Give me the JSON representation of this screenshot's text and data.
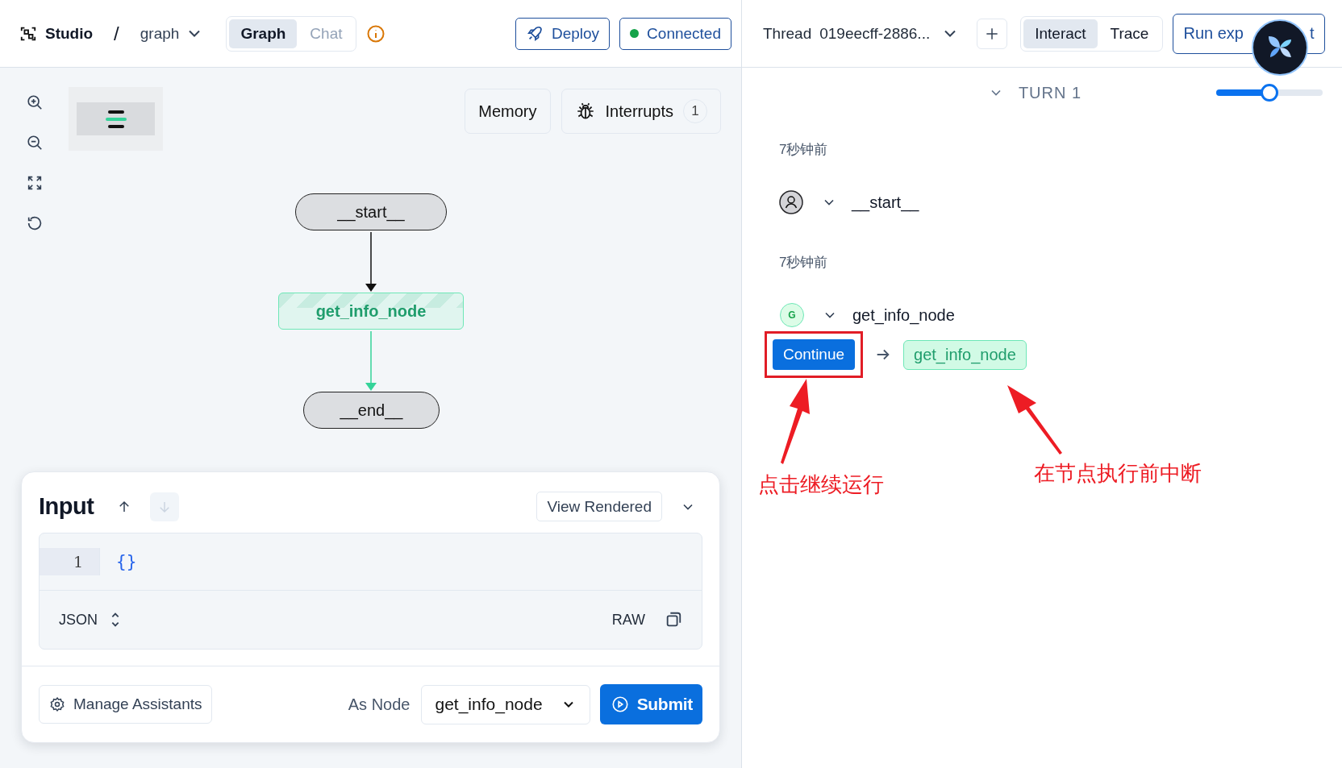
{
  "header": {
    "logo": "Studio",
    "separator": "/",
    "graph_name": "graph",
    "view_tabs": [
      {
        "label": "Graph",
        "selected": true
      },
      {
        "label": "Chat",
        "selected": false
      }
    ],
    "deploy": "Deploy",
    "connection": {
      "label": "Connected",
      "connected": true
    }
  },
  "canvas": {
    "memory": "Memory",
    "interrupts": {
      "label": "Interrupts",
      "count": "1"
    },
    "nodes": [
      {
        "label": "__start__",
        "kind": "terminal"
      },
      {
        "label": "get_info_node",
        "kind": "interrupted"
      },
      {
        "label": "__end__",
        "kind": "terminal"
      }
    ]
  },
  "input_panel": {
    "title": "Input",
    "history_nav": [
      {
        "kind": "up",
        "disabled": false
      },
      {
        "kind": "down",
        "disabled": true
      }
    ],
    "view_mode": "View Rendered",
    "editor": {
      "lines": [
        {
          "number": "1",
          "code": "{}"
        }
      ],
      "format": "JSON",
      "raw_label": "RAW"
    },
    "manage": "Manage Assistants",
    "as_node_label": "As Node",
    "as_node": "get_info_node",
    "submit": "Submit"
  },
  "thread": {
    "label": "Thread",
    "id": "019eecff-2886...",
    "mode_tabs": [
      {
        "label": "Interact",
        "selected": true
      },
      {
        "label": "Trace",
        "selected": false
      }
    ],
    "run_button": [
      "Run exp",
      "t"
    ]
  },
  "turn": {
    "label": "TURN 1",
    "expanded": true,
    "level": 0.5
  },
  "steps": [
    {
      "time": "7秒钟前",
      "avatar": {
        "kind": "user"
      },
      "node": "__start__"
    },
    {
      "time": "7秒钟前",
      "avatar": {
        "kind": "letter",
        "text": "G"
      },
      "node": "get_info_node",
      "continue": "Continue",
      "next": "get_info_node"
    }
  ],
  "annotations": [
    {
      "text": "点击继续运行"
    },
    {
      "text": "在节点执行前中断"
    }
  ]
}
